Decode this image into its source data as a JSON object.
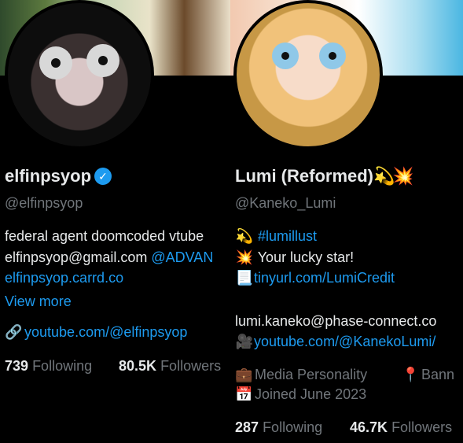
{
  "left": {
    "name": "elfinpsyop",
    "handle": "@elfinpsyop",
    "bio_line1": "federal agent doomcoded vtube",
    "bio_line2_text": "elfinpsyop@gmail.com ",
    "bio_line2_link": "@ADVAN",
    "bio_line3_link": "elfinpsyop.carrd.co",
    "view_more": "View more",
    "website": "youtube.com/@elfinpsyop",
    "following_count": "739",
    "following_label": "Following",
    "followers_count": "80.5K",
    "followers_label": "Followers"
  },
  "right": {
    "name": "Lumi (Reformed)",
    "handle": "@Kaneko_Lumi",
    "bio_line1_link": "#lumillust",
    "bio_line2": "Your lucky star!",
    "bio_line3_link": "tinyurl.com/LumiCredit",
    "bio_line4": "lumi.kaneko@phase-connect.co",
    "bio_line5_link": "youtube.com/@KanekoLumi/",
    "category": "Media Personality",
    "location": "Bann",
    "joined": "Joined June 2023",
    "following_count": "287",
    "following_label": "Following",
    "followers_count": "46.7K",
    "followers_label": "Followers"
  },
  "icons": {
    "verified": "verified-badge-icon",
    "link": "link-icon",
    "briefcase": "briefcase-icon",
    "location": "location-pin-icon",
    "calendar": "calendar-icon"
  },
  "colors": {
    "background": "#000000",
    "text": "#e7e9ea",
    "muted": "#71767b",
    "link": "#1d9bf0"
  }
}
